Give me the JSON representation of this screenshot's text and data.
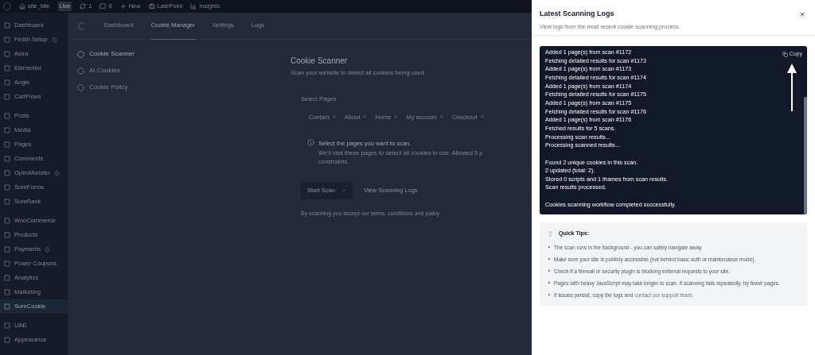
{
  "admin_bar": {
    "site_title": "site_title",
    "live_badge": "Live",
    "items": [
      {
        "kind": "updates",
        "label": "1"
      },
      {
        "kind": "comments",
        "label": "0"
      },
      {
        "kind": "new",
        "label": "New"
      },
      {
        "kind": "latepoint",
        "label": "LatePoint"
      },
      {
        "kind": "insights",
        "label": "Insights"
      }
    ]
  },
  "sidebar": {
    "groups": [
      [
        {
          "label": "Dashboard",
          "badge": false,
          "selected": false
        },
        {
          "label": "Finish Setup",
          "badge": true,
          "selected": false
        },
        {
          "label": "Astra",
          "badge": false,
          "selected": false
        },
        {
          "label": "Elementor",
          "badge": false,
          "selected": false
        },
        {
          "label": "Angie",
          "badge": false,
          "selected": false
        },
        {
          "label": "CartFlows",
          "badge": false,
          "selected": false
        }
      ],
      [
        {
          "label": "Posts",
          "badge": false,
          "selected": false
        },
        {
          "label": "Media",
          "badge": false,
          "selected": false
        },
        {
          "label": "Pages",
          "badge": false,
          "selected": false
        },
        {
          "label": "Comments",
          "badge": false,
          "selected": false
        },
        {
          "label": "OptinMonster",
          "badge": true,
          "selected": false
        },
        {
          "label": "SureForms",
          "badge": false,
          "selected": false
        },
        {
          "label": "SureRank",
          "badge": false,
          "selected": false
        }
      ],
      [
        {
          "label": "WooCommerce",
          "badge": false,
          "selected": false
        },
        {
          "label": "Products",
          "badge": false,
          "selected": false
        },
        {
          "label": "Payments",
          "badge": true,
          "selected": false
        },
        {
          "label": "Power Coupons",
          "badge": false,
          "selected": false
        },
        {
          "label": "Analytics",
          "badge": false,
          "selected": false
        },
        {
          "label": "Marketing",
          "badge": false,
          "selected": false
        },
        {
          "label": "SureCookie",
          "badge": false,
          "selected": true
        }
      ],
      [
        {
          "label": "UAE",
          "badge": false,
          "selected": false
        },
        {
          "label": "Appearance",
          "badge": false,
          "selected": false
        }
      ]
    ]
  },
  "plugin_tabs": [
    {
      "label": "Dashboard",
      "selected": false
    },
    {
      "label": "Cookie Manager",
      "selected": true
    },
    {
      "label": "Settings",
      "selected": false
    },
    {
      "label": "Logs",
      "selected": false
    }
  ],
  "sub_nav": [
    {
      "label": "Cookie Scanner",
      "selected": true
    },
    {
      "label": "AI Cookies",
      "selected": false
    },
    {
      "label": "Cookie Policy",
      "selected": false
    }
  ],
  "scanner": {
    "title": "Cookie Scanner",
    "subtitle": "Scan your website to detect all cookies being used.",
    "select_label": "Select Pages",
    "pages": [
      "Contact",
      "About",
      "Home",
      "My account",
      "Checkout"
    ],
    "info": {
      "title": "Select the pages you want to scan.",
      "lines": [
        "We'll visit these pages to detect all cookies in use. Allowed 5 p",
        "constraints."
      ]
    },
    "start_button": "Start Scan",
    "logs_link": "View Scanning Logs",
    "footer": "By scanning you accept our terms, conditions and policy"
  },
  "panel": {
    "title": "Latest Scanning Logs",
    "subtitle": "View logs from the most recent cookie scanning process.",
    "copy_button": "Copy",
    "log_groups": [
      [
        "Added 1 page(s) from scan #1172",
        "Fetching detailed results for scan #1173",
        "Added 1 page(s) from scan #1173",
        "Fetching detailed results for scan #1174",
        "Added 1 page(s) from scan #1174",
        "Fetching detailed results for scan #1175",
        "Added 1 page(s) from scan #1175",
        "Fetching detailed results for scan #1176",
        "Added 1 page(s) from scan #1176",
        "Fetched results for 5 scans.",
        "Processing scan results...",
        "Processing scanned results..."
      ],
      [
        "Found 2 unique cookies in this scan.",
        "2 updated (total: 2).",
        "Stored 0 scripts and 1 iframes from scan results.",
        "Scan results processed."
      ],
      [
        "Cookies scanning workflow completed successfully."
      ]
    ],
    "tips_title": "Quick Tips:",
    "tips": [
      {
        "text": "The scan runs in the background - you can safely navigate away."
      },
      {
        "text": "Make sure your site is publicly accessible (not behind basic auth or maintenance mode)."
      },
      {
        "text": "Check if a firewall or security plugin is blocking external requests to your site."
      },
      {
        "text": "Pages with heavy JavaScript may take longer to scan. If scanning fails repeatedly, try fewer pages."
      },
      {
        "text": "If issues persist, copy the logs and ",
        "link": "contact our support team",
        "after": "."
      }
    ]
  }
}
